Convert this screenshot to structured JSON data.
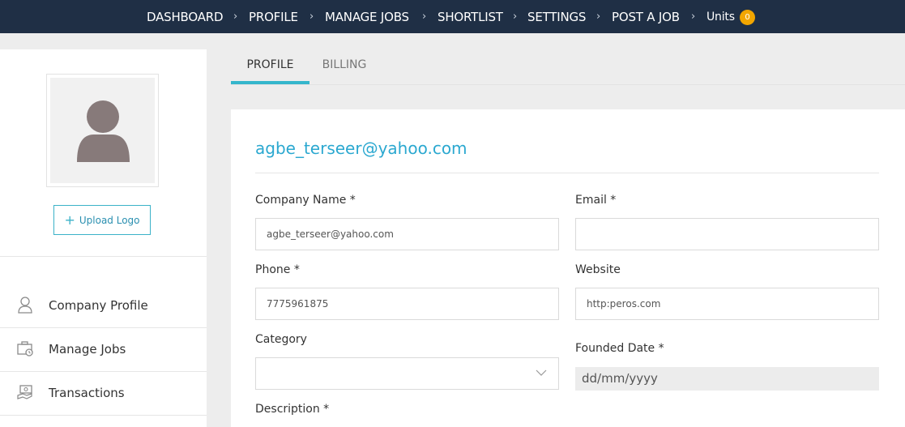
{
  "nav": {
    "dashboard": "DASHBOARD",
    "profile": "PROFILE",
    "manage_jobs": "MANAGE JOBS",
    "shortlist": "SHORTLIST",
    "settings": "SETTINGS",
    "post_a_job": "POST A JOB",
    "units": "Units",
    "units_count": "0",
    "separator": "›"
  },
  "sidebar": {
    "upload_label": "Upload Logo",
    "upload_icon": "plus-icon",
    "items": [
      {
        "label": "Company Profile",
        "icon": "user-icon"
      },
      {
        "label": "Manage Jobs",
        "icon": "briefcase-icon"
      },
      {
        "label": "Transactions",
        "icon": "money-icon"
      }
    ]
  },
  "tabs": [
    {
      "label": "PROFILE",
      "active": true
    },
    {
      "label": "BILLING",
      "active": false
    }
  ],
  "form": {
    "title": "agbe_terseer@yahoo.com",
    "company_name": {
      "label": "Company Name *",
      "value": "agbe_terseer@yahoo.com"
    },
    "email": {
      "label": "Email *",
      "value": ""
    },
    "phone": {
      "label": "Phone *",
      "value": "7775961875"
    },
    "website": {
      "label": "Website",
      "value": "http:peros.com"
    },
    "category": {
      "label": "Category",
      "value": ""
    },
    "founded_date": {
      "label": "Founded Date *",
      "value": "dd/mm/yyyy"
    },
    "description": {
      "label": "Description *"
    }
  },
  "colors": {
    "nav_bg": "#1f2f45",
    "accent": "#35b6cc",
    "badge": "#f2a600",
    "title": "#2ba8d0"
  }
}
